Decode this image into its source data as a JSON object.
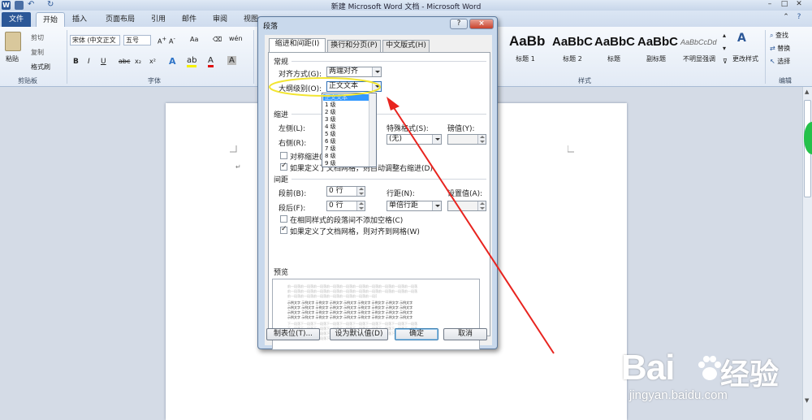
{
  "window": {
    "title": "新建 Microsoft Word 文档 - Microsoft Word"
  },
  "ribbon_tabs": [
    "文件",
    "开始",
    "插入",
    "页面布局",
    "引用",
    "邮件",
    "审阅",
    "视图"
  ],
  "clipboard": {
    "paste": "粘贴",
    "cut": "剪切",
    "copy": "复制",
    "format_painter": "格式刷",
    "group": "剪贴板"
  },
  "font": {
    "name": "宋体 (中文正文",
    "size": "五号",
    "group": "字体",
    "bold": "B",
    "italic": "I",
    "underline": "U",
    "strike": "abc",
    "sub": "x₂",
    "sup": "x²"
  },
  "styles": {
    "items": [
      {
        "sample": "AaBb",
        "name": "标题 1"
      },
      {
        "sample": "AaBbC",
        "name": "标题 2"
      },
      {
        "sample": "AaBbC",
        "name": "标题"
      },
      {
        "sample": "AaBbC",
        "name": "副标题"
      },
      {
        "sample": "AaBbCcDd",
        "name": "不明显强调"
      }
    ],
    "change": "更改样式",
    "group": "样式"
  },
  "editing": {
    "find": "查找",
    "replace": "替换",
    "select": "选择",
    "group": "编辑"
  },
  "dialog": {
    "title": "段落",
    "help": "?",
    "close": "×",
    "tabs": [
      "缩进和间距(I)",
      "换行和分页(P)",
      "中文版式(H)"
    ],
    "general": {
      "section": "常规",
      "alignment_label": "对齐方式(G):",
      "alignment_value": "两端对齐",
      "outline_label": "大纲级别(O):",
      "outline_value": "正文文本",
      "outline_options": [
        "正文文本",
        "1 级",
        "2 级",
        "3 级",
        "4 级",
        "5 级",
        "6 级",
        "7 级",
        "8 级",
        "9 级"
      ]
    },
    "indent": {
      "section": "缩进",
      "left_label": "左侧(L):",
      "right_label": "右侧(R):",
      "special_label": "特殊格式(S):",
      "special_value": "(无)",
      "by_label": "磅值(Y):",
      "mirror": "对称缩进(M)",
      "auto_adjust": "如果定义了文档网格，则自动调整右缩进(D)"
    },
    "spacing": {
      "section": "间距",
      "before_label": "段前(B):",
      "before_value": "0 行",
      "after_label": "段后(F):",
      "after_value": "0 行",
      "line_label": "行距(N):",
      "line_value": "单倍行距",
      "at_label": "设置值(A):",
      "no_space": "在相同样式的段落间不添加空格(C)",
      "snap_grid": "如果定义了文档网格，则对齐到网格(W)"
    },
    "preview": {
      "section": "预览",
      "prev_line": "前一段落前一段落前一段落前一段落前一段落前一段落前一段落前一段落前一段落前一段落",
      "sample_line": "示例文字 示例文字 示例文字 示例文字 示例文字 示例文字 示例文字 示例文字 示例文字",
      "next_line": "下一段落下一段落下一段落下一段落下一段落下一段落下一段落下一段落下一段落下一段落"
    },
    "buttons": {
      "tabs": "制表位(T)...",
      "default": "设为默认值(D)",
      "ok": "确定",
      "cancel": "取消"
    }
  },
  "watermark": {
    "brand": "Bai",
    "cn": "经验",
    "url": "jingyan.baidu.com"
  },
  "colors": {
    "file_tab": "#2b5797",
    "highlight": "#3399ff",
    "annotation_arrow": "#e8241f",
    "annotation_ellipse": "#f2e531"
  }
}
